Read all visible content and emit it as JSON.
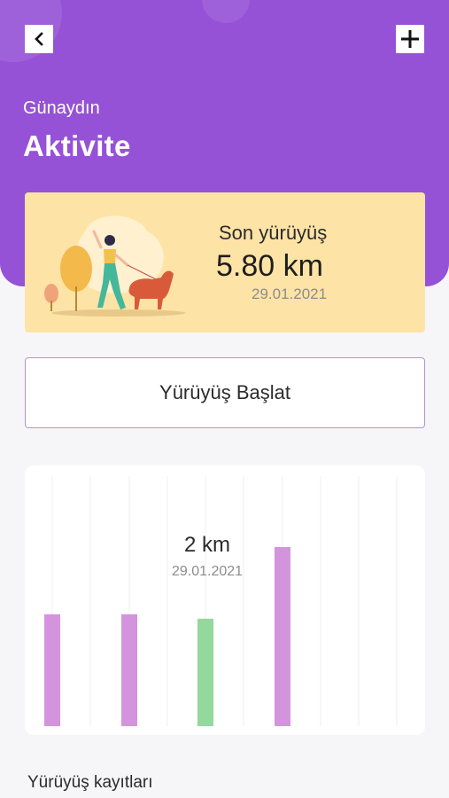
{
  "header": {
    "greeting": "Günaydın",
    "title": "Aktivite",
    "back_icon": "chevron-left-icon",
    "add_icon": "plus-icon"
  },
  "last_walk": {
    "label": "Son yürüyüş",
    "distance": "5.80 km",
    "date": "29.01.2021"
  },
  "start_button": {
    "label": "Yürüyüş Başlat"
  },
  "chart_data": {
    "type": "bar",
    "values": [
      1.25,
      1.25,
      1.2,
      2.0
    ],
    "selected_index": 2,
    "colors": {
      "default": "#d494dd",
      "selected": "#93d89c"
    },
    "tooltip": {
      "value": "2 km",
      "date": "29.01.2021"
    },
    "grid": true
  },
  "records": {
    "title": "Yürüyüş kayıtları"
  },
  "theme": {
    "primary": "#9652d6",
    "card_bg": "#fde3a5",
    "page_bg": "#f6f6f9"
  }
}
